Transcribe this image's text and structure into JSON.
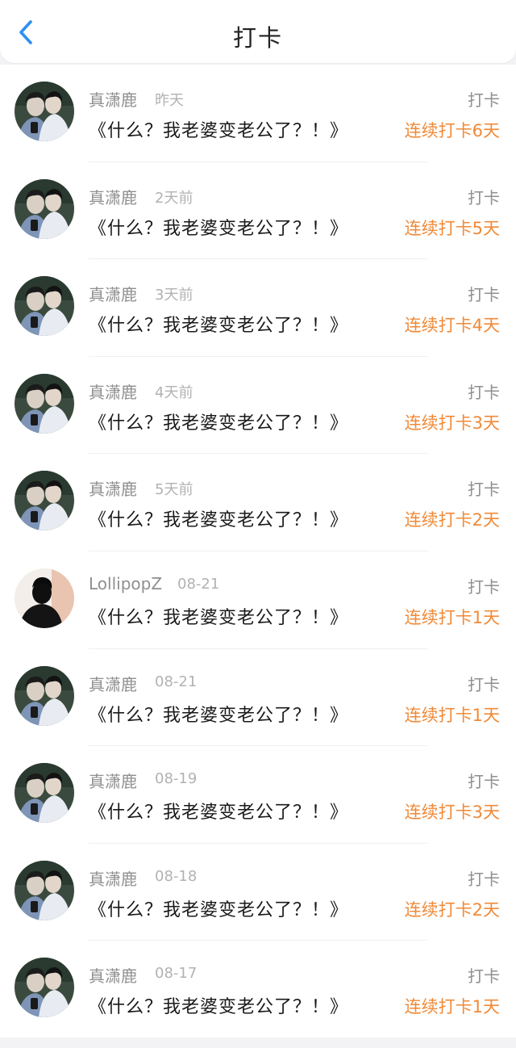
{
  "header": {
    "title": "打卡"
  },
  "colors": {
    "accent_orange": "#f08a38",
    "back_blue": "#2f8ff0"
  },
  "entries": [
    {
      "name": "真潇鹿",
      "time": "昨天",
      "tag": "打卡",
      "book": "《什么？我老婆变老公了？！》",
      "streak": "连续打卡6天",
      "avatar": "couple-avatar"
    },
    {
      "name": "真潇鹿",
      "time": "2天前",
      "tag": "打卡",
      "book": "《什么？我老婆变老公了？！》",
      "streak": "连续打卡5天",
      "avatar": "couple-avatar"
    },
    {
      "name": "真潇鹿",
      "time": "3天前",
      "tag": "打卡",
      "book": "《什么？我老婆变老公了？！》",
      "streak": "连续打卡4天",
      "avatar": "couple-avatar"
    },
    {
      "name": "真潇鹿",
      "time": "4天前",
      "tag": "打卡",
      "book": "《什么？我老婆变老公了？！》",
      "streak": "连续打卡3天",
      "avatar": "couple-avatar"
    },
    {
      "name": "真潇鹿",
      "time": "5天前",
      "tag": "打卡",
      "book": "《什么？我老婆变老公了？！》",
      "streak": "连续打卡2天",
      "avatar": "couple-avatar"
    },
    {
      "name": "LollipopZ",
      "time": "08-21",
      "tag": "打卡",
      "book": "《什么？我老婆变老公了？！》",
      "streak": "连续打卡1天",
      "avatar": "silhouette-avatar"
    },
    {
      "name": "真潇鹿",
      "time": "08-21",
      "tag": "打卡",
      "book": "《什么？我老婆变老公了？！》",
      "streak": "连续打卡1天",
      "avatar": "couple-avatar"
    },
    {
      "name": "真潇鹿",
      "time": "08-19",
      "tag": "打卡",
      "book": "《什么？我老婆变老公了？！》",
      "streak": "连续打卡3天",
      "avatar": "couple-avatar"
    },
    {
      "name": "真潇鹿",
      "time": "08-18",
      "tag": "打卡",
      "book": "《什么？我老婆变老公了？！》",
      "streak": "连续打卡2天",
      "avatar": "couple-avatar"
    },
    {
      "name": "真潇鹿",
      "time": "08-17",
      "tag": "打卡",
      "book": "《什么？我老婆变老公了？！》",
      "streak": "连续打卡1天",
      "avatar": "couple-avatar"
    }
  ]
}
